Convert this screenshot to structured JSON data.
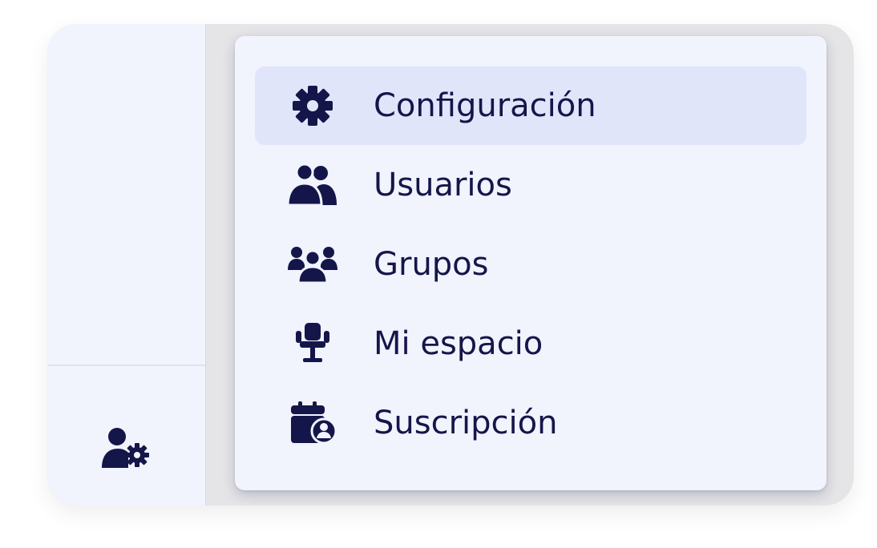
{
  "colors": {
    "icon": "#14164a",
    "text": "#14164a",
    "panel": "#f1f3fd",
    "active": "#e1e5f9"
  },
  "sidebar": {
    "footer_icon": "user-gear-icon"
  },
  "menu": {
    "items": [
      {
        "label": "Configuración",
        "icon": "gear-icon",
        "active": true
      },
      {
        "label": "Usuarios",
        "icon": "users-icon",
        "active": false
      },
      {
        "label": "Grupos",
        "icon": "group-icon",
        "active": false
      },
      {
        "label": "Mi espacio",
        "icon": "chair-icon",
        "active": false
      },
      {
        "label": "Suscripción",
        "icon": "calendar-user-icon",
        "active": false
      }
    ]
  }
}
